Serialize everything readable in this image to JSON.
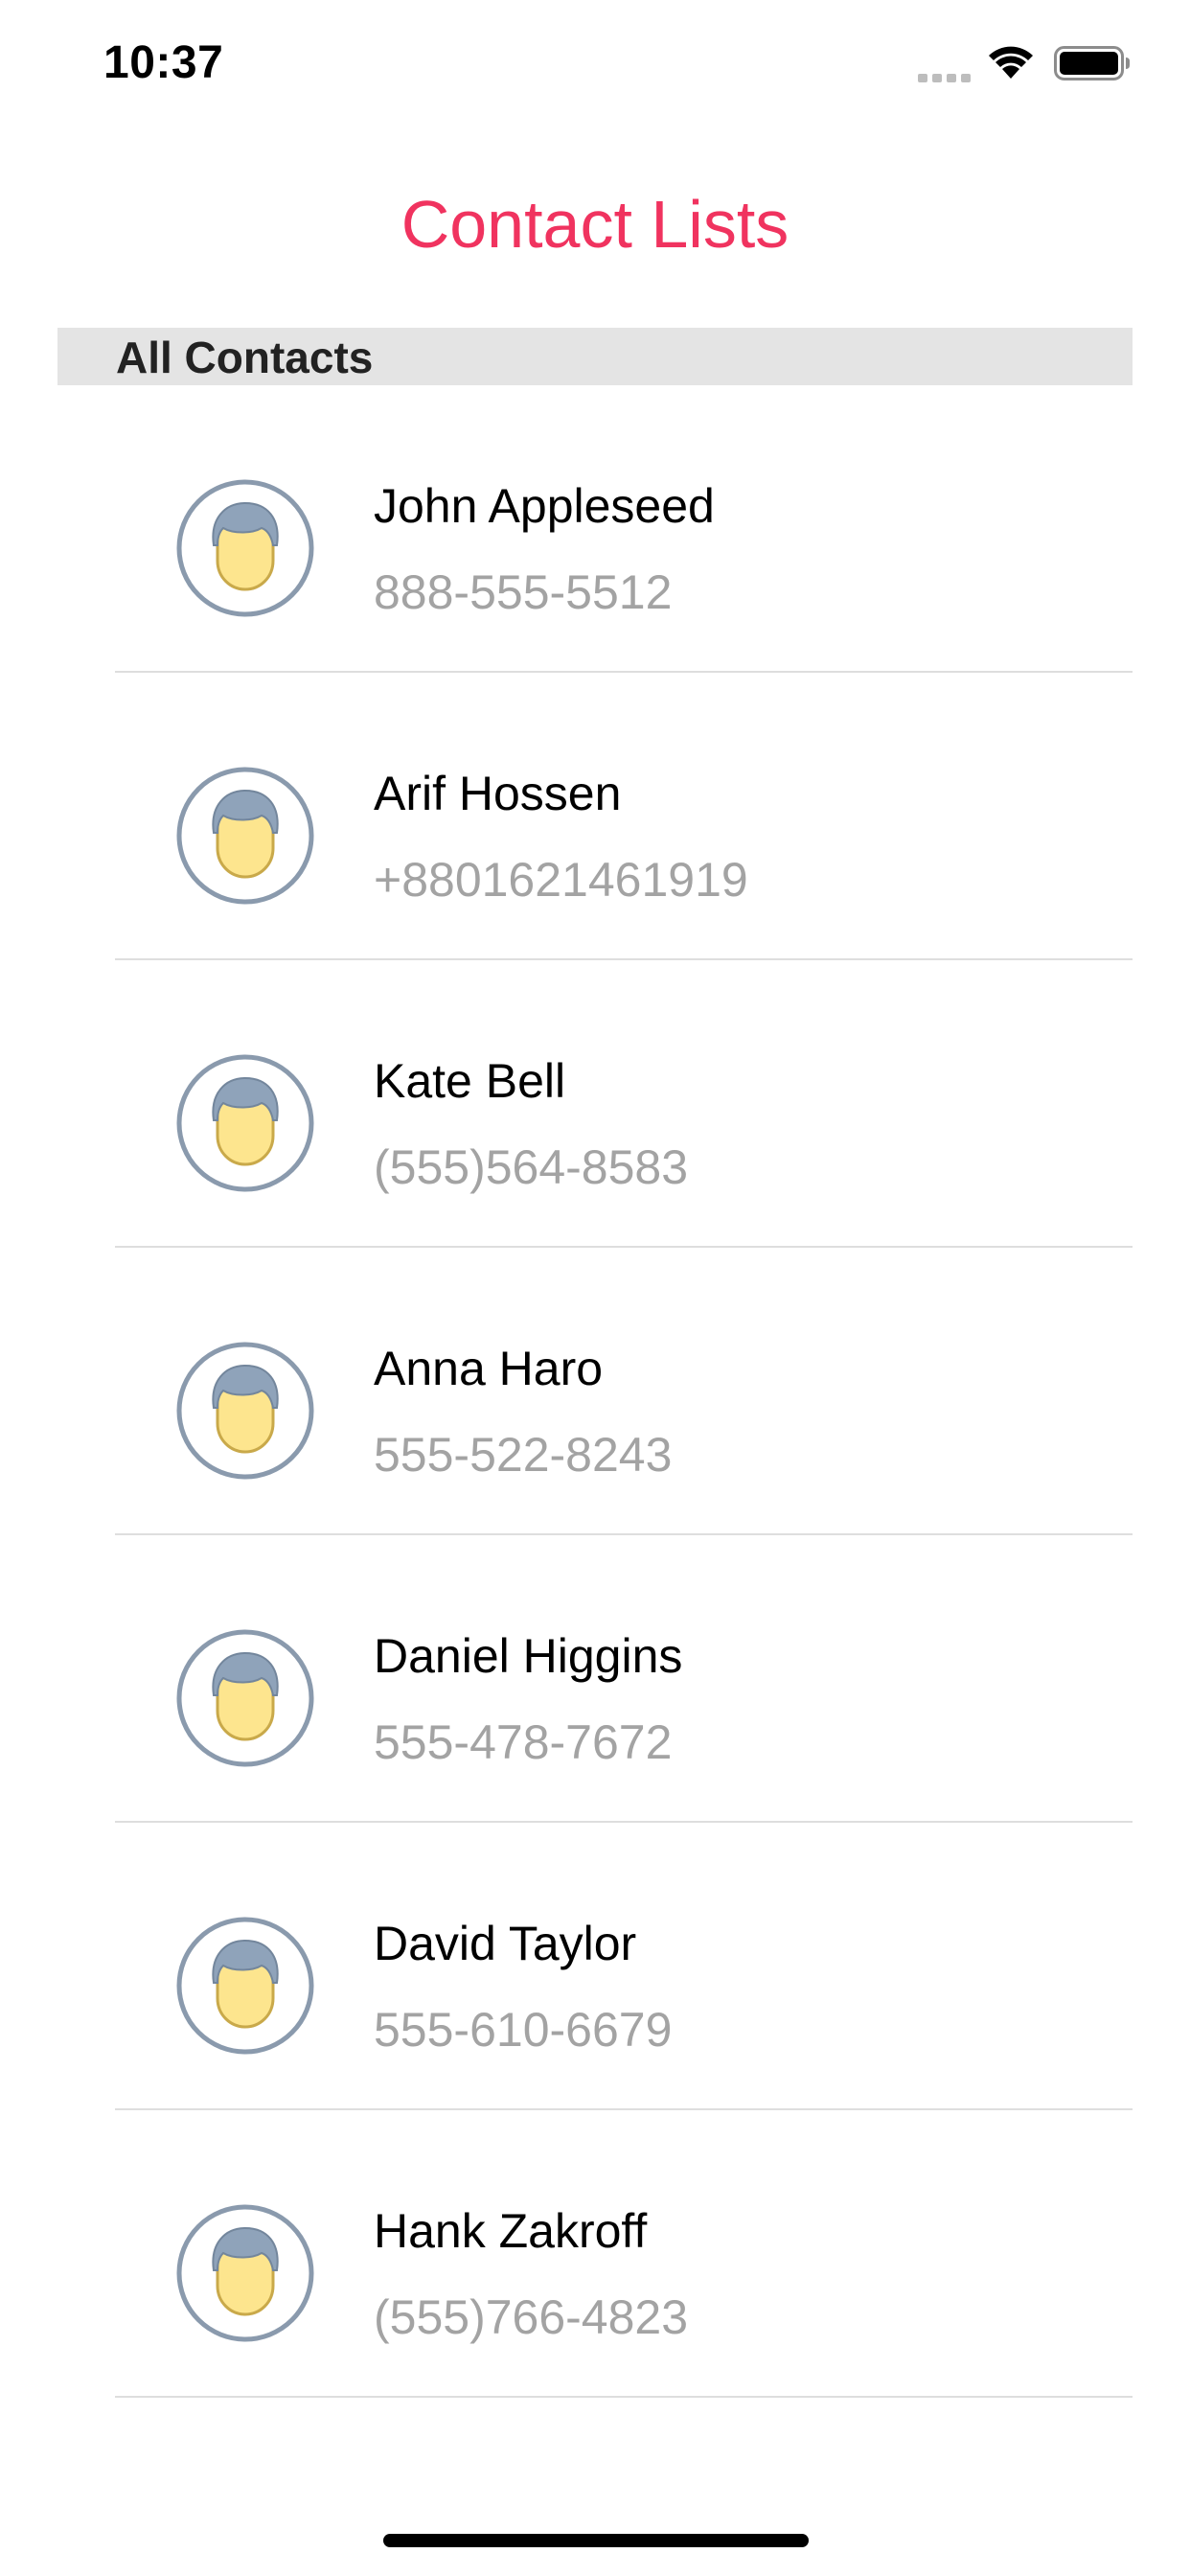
{
  "status_bar": {
    "time": "10:37",
    "icons": [
      "cellular-signal-icon",
      "wifi-icon",
      "battery-icon"
    ]
  },
  "nav": {
    "title": "Contact Lists",
    "title_color": "#f0335f"
  },
  "section": {
    "header": "All Contacts"
  },
  "contacts": [
    {
      "name": "John Appleseed",
      "phone": "888-555-5512",
      "icon": "person-avatar-icon"
    },
    {
      "name": "Arif Hossen",
      "phone": "+8801621461919",
      "icon": "person-avatar-icon"
    },
    {
      "name": "Kate Bell",
      "phone": "(555)564-8583",
      "icon": "person-avatar-icon"
    },
    {
      "name": "Anna Haro",
      "phone": "555-522-8243",
      "icon": "person-avatar-icon"
    },
    {
      "name": "Daniel Higgins",
      "phone": "555-478-7672",
      "icon": "person-avatar-icon"
    },
    {
      "name": "David Taylor",
      "phone": "555-610-6679",
      "icon": "person-avatar-icon"
    },
    {
      "name": "Hank Zakroff",
      "phone": "(555)766-4823",
      "icon": "person-avatar-icon"
    }
  ]
}
